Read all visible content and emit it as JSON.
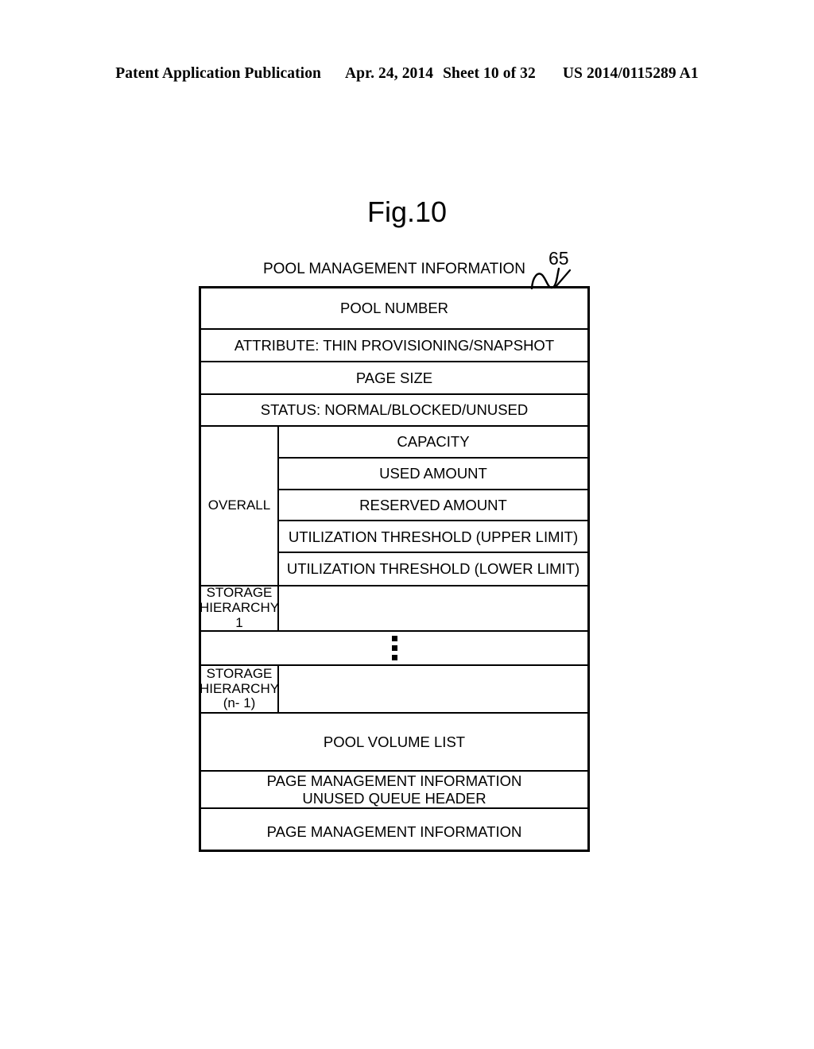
{
  "page_header": {
    "publication": "Patent Application Publication",
    "date": "Apr. 24, 2014",
    "sheet": "Sheet 10 of 32",
    "patent_number": "US 2014/0115289 A1"
  },
  "figure": {
    "title": "Fig.10",
    "caption": "POOL MANAGEMENT INFORMATION",
    "reference_numeral": "65"
  },
  "table": {
    "rows": [
      {
        "label": "",
        "value": "POOL NUMBER"
      },
      {
        "label": "",
        "value": "ATTRIBUTE: THIN PROVISIONING/SNAPSHOT"
      },
      {
        "label": "",
        "value": "PAGE SIZE"
      },
      {
        "label": "",
        "value": "STATUS: NORMAL/BLOCKED/UNUSED"
      }
    ],
    "overall": {
      "label": "OVERALL",
      "sub_rows": [
        "CAPACITY",
        "USED AMOUNT",
        "RESERVED AMOUNT",
        "UTILIZATION THRESHOLD (UPPER LIMIT)",
        "UTILIZATION THRESHOLD (LOWER LIMIT)"
      ]
    },
    "hierarchy_first": {
      "label": "STORAGE\nHIERARCHY\n1",
      "value": ""
    },
    "ellipsis": "vertical-ellipsis",
    "hierarchy_last": {
      "label": "STORAGE\nHIERARCHY\n(n- 1)",
      "value": ""
    },
    "footer_rows": [
      "POOL VOLUME LIST",
      "PAGE MANAGEMENT INFORMATION\nUNUSED QUEUE HEADER",
      "PAGE MANAGEMENT INFORMATION"
    ]
  },
  "colors": {
    "ink": "#000000",
    "paper": "#ffffff"
  }
}
